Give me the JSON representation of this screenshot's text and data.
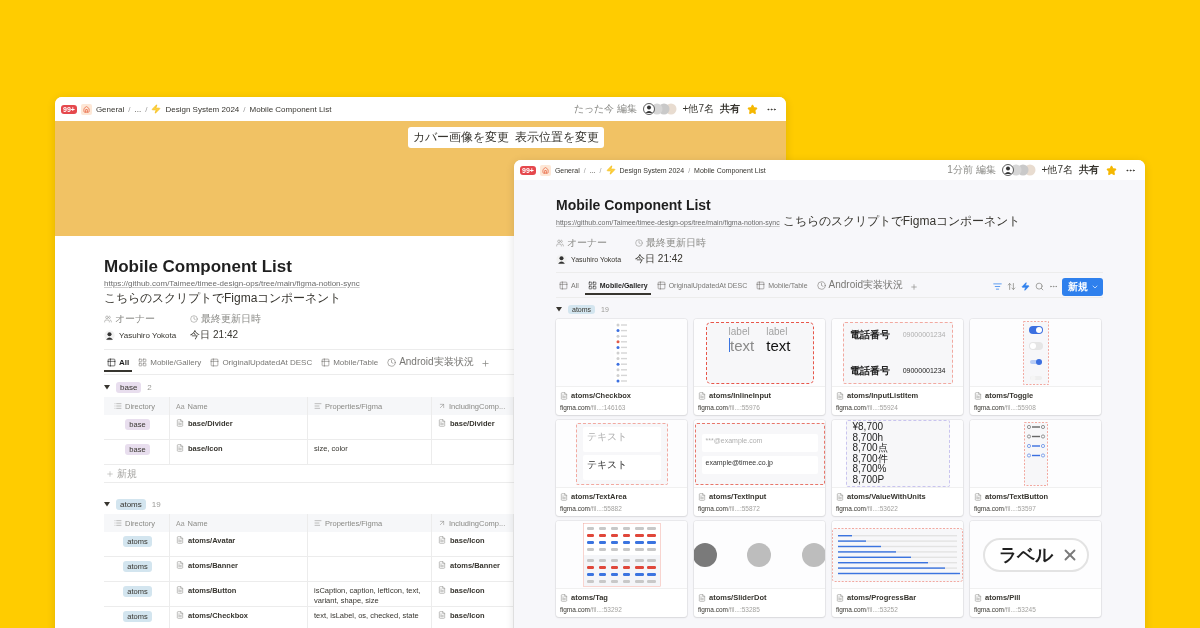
{
  "back_window": {
    "topbar": {
      "badge": "99+",
      "crumbs": [
        {
          "label": "General",
          "separator": "/"
        },
        {
          "label": "...",
          "separator": "/"
        },
        {
          "label": "Design System 2024",
          "separator": "/"
        },
        {
          "label": "Mobile Component List"
        }
      ],
      "edited": "たった今 編集",
      "others": "+他7名",
      "share": "共有",
      "favorite": true
    },
    "cover_buttons": [
      "カバー画像を変更",
      "表示位置を変更"
    ],
    "title": "Mobile Component List",
    "description": {
      "link": "https://github.com/Taimee/timee-design-ops/tree/main/figma-notion-sync",
      "text": "こちらのスクリプトでFigmaコンポーネント"
    },
    "properties": [
      {
        "label": "オーナー",
        "value": "Yasuhiro Yokota",
        "kind": "person"
      },
      {
        "label": "最終更新日時",
        "value": "今日 21:42",
        "kind": "date"
      }
    ],
    "tabs": [
      {
        "label": "All",
        "kind": "table",
        "selected": true
      },
      {
        "label": "Mobile/Gallery",
        "kind": "gallery",
        "selected": false
      },
      {
        "label": "OriginalUpdatedAt DESC",
        "kind": "table",
        "selected": false
      },
      {
        "label": "Mobile/Table",
        "kind": "table",
        "selected": false
      },
      {
        "label": "Android実装状況",
        "kind": "timeline",
        "selected": false
      }
    ],
    "groups": [
      {
        "tag": "base",
        "color": "#e8deee",
        "count": "2",
        "expanded": true,
        "new_row": "新規",
        "columns": [
          {
            "label": "Directory",
            "kind": "select"
          },
          {
            "label": "Name",
            "kind": "title",
            "icon_text": "Aa"
          },
          {
            "label": "Properties/Figma",
            "kind": "text"
          },
          {
            "label": "IncludingComp...",
            "kind": "relation"
          }
        ],
        "rows": [
          {
            "directory": "base",
            "name": "base/Divider",
            "including": "base/Divider"
          },
          {
            "directory": "base",
            "name": "base/Icon",
            "properties": "size, color"
          }
        ]
      },
      {
        "tag": "atoms",
        "color": "#d3e5ef",
        "count": "19",
        "expanded": true,
        "columns": [
          {
            "label": "Directory",
            "kind": "select"
          },
          {
            "label": "Name",
            "kind": "title",
            "icon_text": "Aa"
          },
          {
            "label": "Properties/Figma",
            "kind": "text"
          },
          {
            "label": "IncludingComp...",
            "kind": "relation"
          }
        ],
        "rows": [
          {
            "directory": "atoms",
            "name": "atoms/Avatar",
            "including": "base/Icon"
          },
          {
            "directory": "atoms",
            "name": "atoms/Banner",
            "including": "atoms/Banner"
          },
          {
            "directory": "atoms",
            "name": "atoms/Button",
            "properties": "isCaption, caption, leftIcon, text, variant, shape, size",
            "including": "base/Icon"
          },
          {
            "directory": "atoms",
            "name": "atoms/Checkbox",
            "properties": "text, isLabel, os, checked, state",
            "including": "base/Icon"
          }
        ]
      }
    ]
  },
  "front_window": {
    "topbar": {
      "badge": "99+",
      "crumbs": [
        {
          "label": "General",
          "separator": "/"
        },
        {
          "label": "...",
          "separator": "/"
        },
        {
          "label": "Design System 2024",
          "separator": "/"
        },
        {
          "label": "Mobile Component List"
        }
      ],
      "edited": "1分前 編集",
      "others": "+他7名",
      "share": "共有",
      "favorite": true
    },
    "title": "Mobile Component List",
    "description": {
      "link": "https://github.com/Taimee/timee-design-ops/tree/main/figma-notion-sync",
      "text": "こちらのスクリプトでFigmaコンポーネント"
    },
    "properties": [
      {
        "label": "オーナー",
        "value": "Yasuhiro Yokota",
        "kind": "person"
      },
      {
        "label": "最終更新日時",
        "value": "今日 21:42",
        "kind": "date"
      }
    ],
    "tabs": [
      {
        "label": "All",
        "kind": "table",
        "selected": false
      },
      {
        "label": "Mobile/Gallery",
        "kind": "gallery",
        "selected": true
      },
      {
        "label": "OriginalUpdatedAt DESC",
        "kind": "table",
        "selected": false
      },
      {
        "label": "Mobile/Table",
        "kind": "table",
        "selected": false
      },
      {
        "label": "Android実装状況",
        "kind": "timeline",
        "selected": false
      }
    ],
    "new_button": "新規",
    "group": {
      "tag": "atoms",
      "color": "#d3e5ef",
      "count": "19",
      "expanded": true
    },
    "cards": [
      {
        "name": "atoms/Checkbox",
        "url_domain": "figma.com",
        "url_path": "/fil...:146163",
        "preview": {
          "kind": "checkbox-list"
        }
      },
      {
        "name": "atoms/InlineInput",
        "url_domain": "figma.com",
        "url_path": "/fil...:55976",
        "preview": {
          "kind": "inline-input",
          "items": [
            {
              "label": "label",
              "value": "text",
              "focused": true
            },
            {
              "label": "label",
              "value": "text",
              "focused": false
            }
          ]
        }
      },
      {
        "name": "atoms/InputListItem",
        "url_domain": "figma.com",
        "url_path": "/fil...:55924",
        "preview": {
          "kind": "input-list",
          "items": [
            {
              "label": "電話番号",
              "placeholder": "09000001234"
            },
            {
              "label": "電話番号",
              "value": "09000001234"
            }
          ]
        }
      },
      {
        "name": "atoms/Toggle",
        "url_domain": "figma.com",
        "url_path": "/fil...:55908",
        "preview": {
          "kind": "toggle"
        }
      },
      {
        "name": "atoms/TextArea",
        "url_domain": "figma.com",
        "url_path": "/fil...:55882",
        "preview": {
          "kind": "text-area",
          "items": [
            {
              "placeholder": "テキスト"
            },
            {
              "value": "テキスト"
            }
          ]
        }
      },
      {
        "name": "atoms/TextInput",
        "url_domain": "figma.com",
        "url_path": "/fil...:55872",
        "preview": {
          "kind": "text-input",
          "placeholder": "***@example.com",
          "value": "example@timee.co.jp"
        }
      },
      {
        "name": "atoms/ValueWithUnits",
        "url_domain": "figma.com",
        "url_path": "/fil...:53622",
        "preview": {
          "kind": "values",
          "values": [
            "¥8,700",
            "8,700h",
            "8,700点",
            "8,700件",
            "8,700%",
            "8,700P"
          ]
        }
      },
      {
        "name": "atoms/TextButton",
        "url_domain": "figma.com",
        "url_path": "/fil...:53597",
        "preview": {
          "kind": "text-button"
        }
      },
      {
        "name": "atoms/Tag",
        "url_domain": "figma.com",
        "url_path": "/fil...:53292",
        "preview": {
          "kind": "tag"
        }
      },
      {
        "name": "atoms/SliderDot",
        "url_domain": "figma.com",
        "url_path": "/fil...:53285",
        "preview": {
          "kind": "slider-dot"
        }
      },
      {
        "name": "atoms/ProgressBar",
        "url_domain": "figma.com",
        "url_path": "/fil...:53252",
        "preview": {
          "kind": "progress-bar"
        }
      },
      {
        "name": "atoms/Pill",
        "url_domain": "figma.com",
        "url_path": "/fil...:53245",
        "preview": {
          "kind": "pill",
          "label": "ラベル"
        }
      }
    ]
  }
}
